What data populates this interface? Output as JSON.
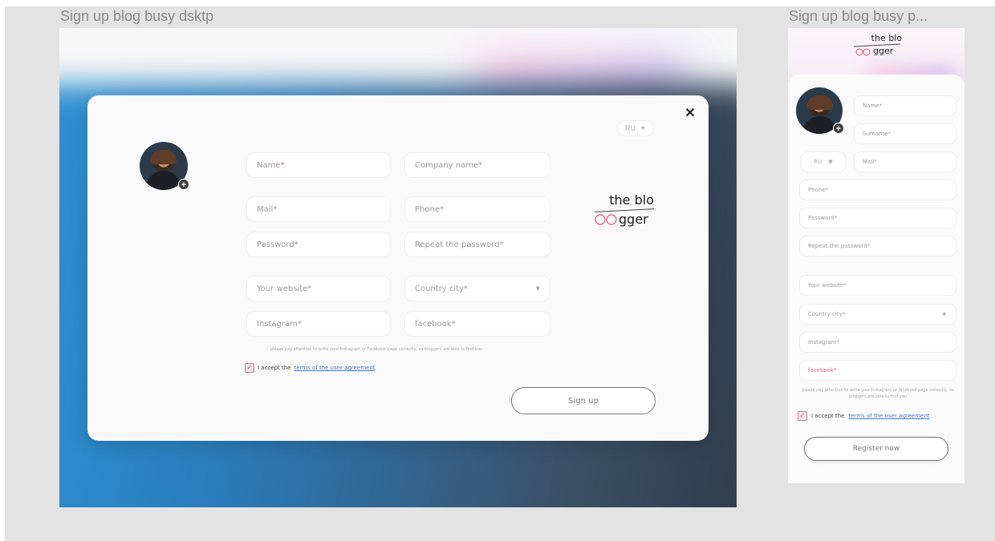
{
  "frames": {
    "desktop_title": "Sign up blog busy dsktp",
    "phone_title": "Sign up blog busy p..."
  },
  "brand": {
    "logo_line1": "the blo",
    "logo_line2": "gger",
    "ring_color": "#e8507a"
  },
  "desktop": {
    "lang": "RU",
    "fields": {
      "name": "Name",
      "name_req": "*",
      "company": "Company name*",
      "mail": "Mail*",
      "phone": "Phone*",
      "password": "Password*",
      "repeat_password": "Repeat the password*",
      "website": "Your website*",
      "country_city": "Country city*",
      "instagram": "Instagram*",
      "facebook": "facebook*"
    },
    "hint": "please pay attention to write your Instagram or Facebook page correctly, so bloggers are able to find you",
    "accept_prefix": "I accept the ",
    "accept_link": "terms of the user agreement",
    "submit": "Sign up"
  },
  "phone": {
    "lang": "RU",
    "fields": {
      "name": "Name*",
      "surname": "Surname*",
      "mail": "Mail*",
      "phone": "Phone*",
      "password": "Password*",
      "repeat_password": "Repeat the password*",
      "website": "Your website*",
      "country_city": "Country city*",
      "instagram": "Instagram*",
      "facebook": "facebook*"
    },
    "hint": "please pay attention to write your Instagram or facebook page correctly, so bloggers are able to find you",
    "accept_prefix": "I accept the ",
    "accept_link": "terms of the user agreement",
    "submit": "Register now"
  }
}
